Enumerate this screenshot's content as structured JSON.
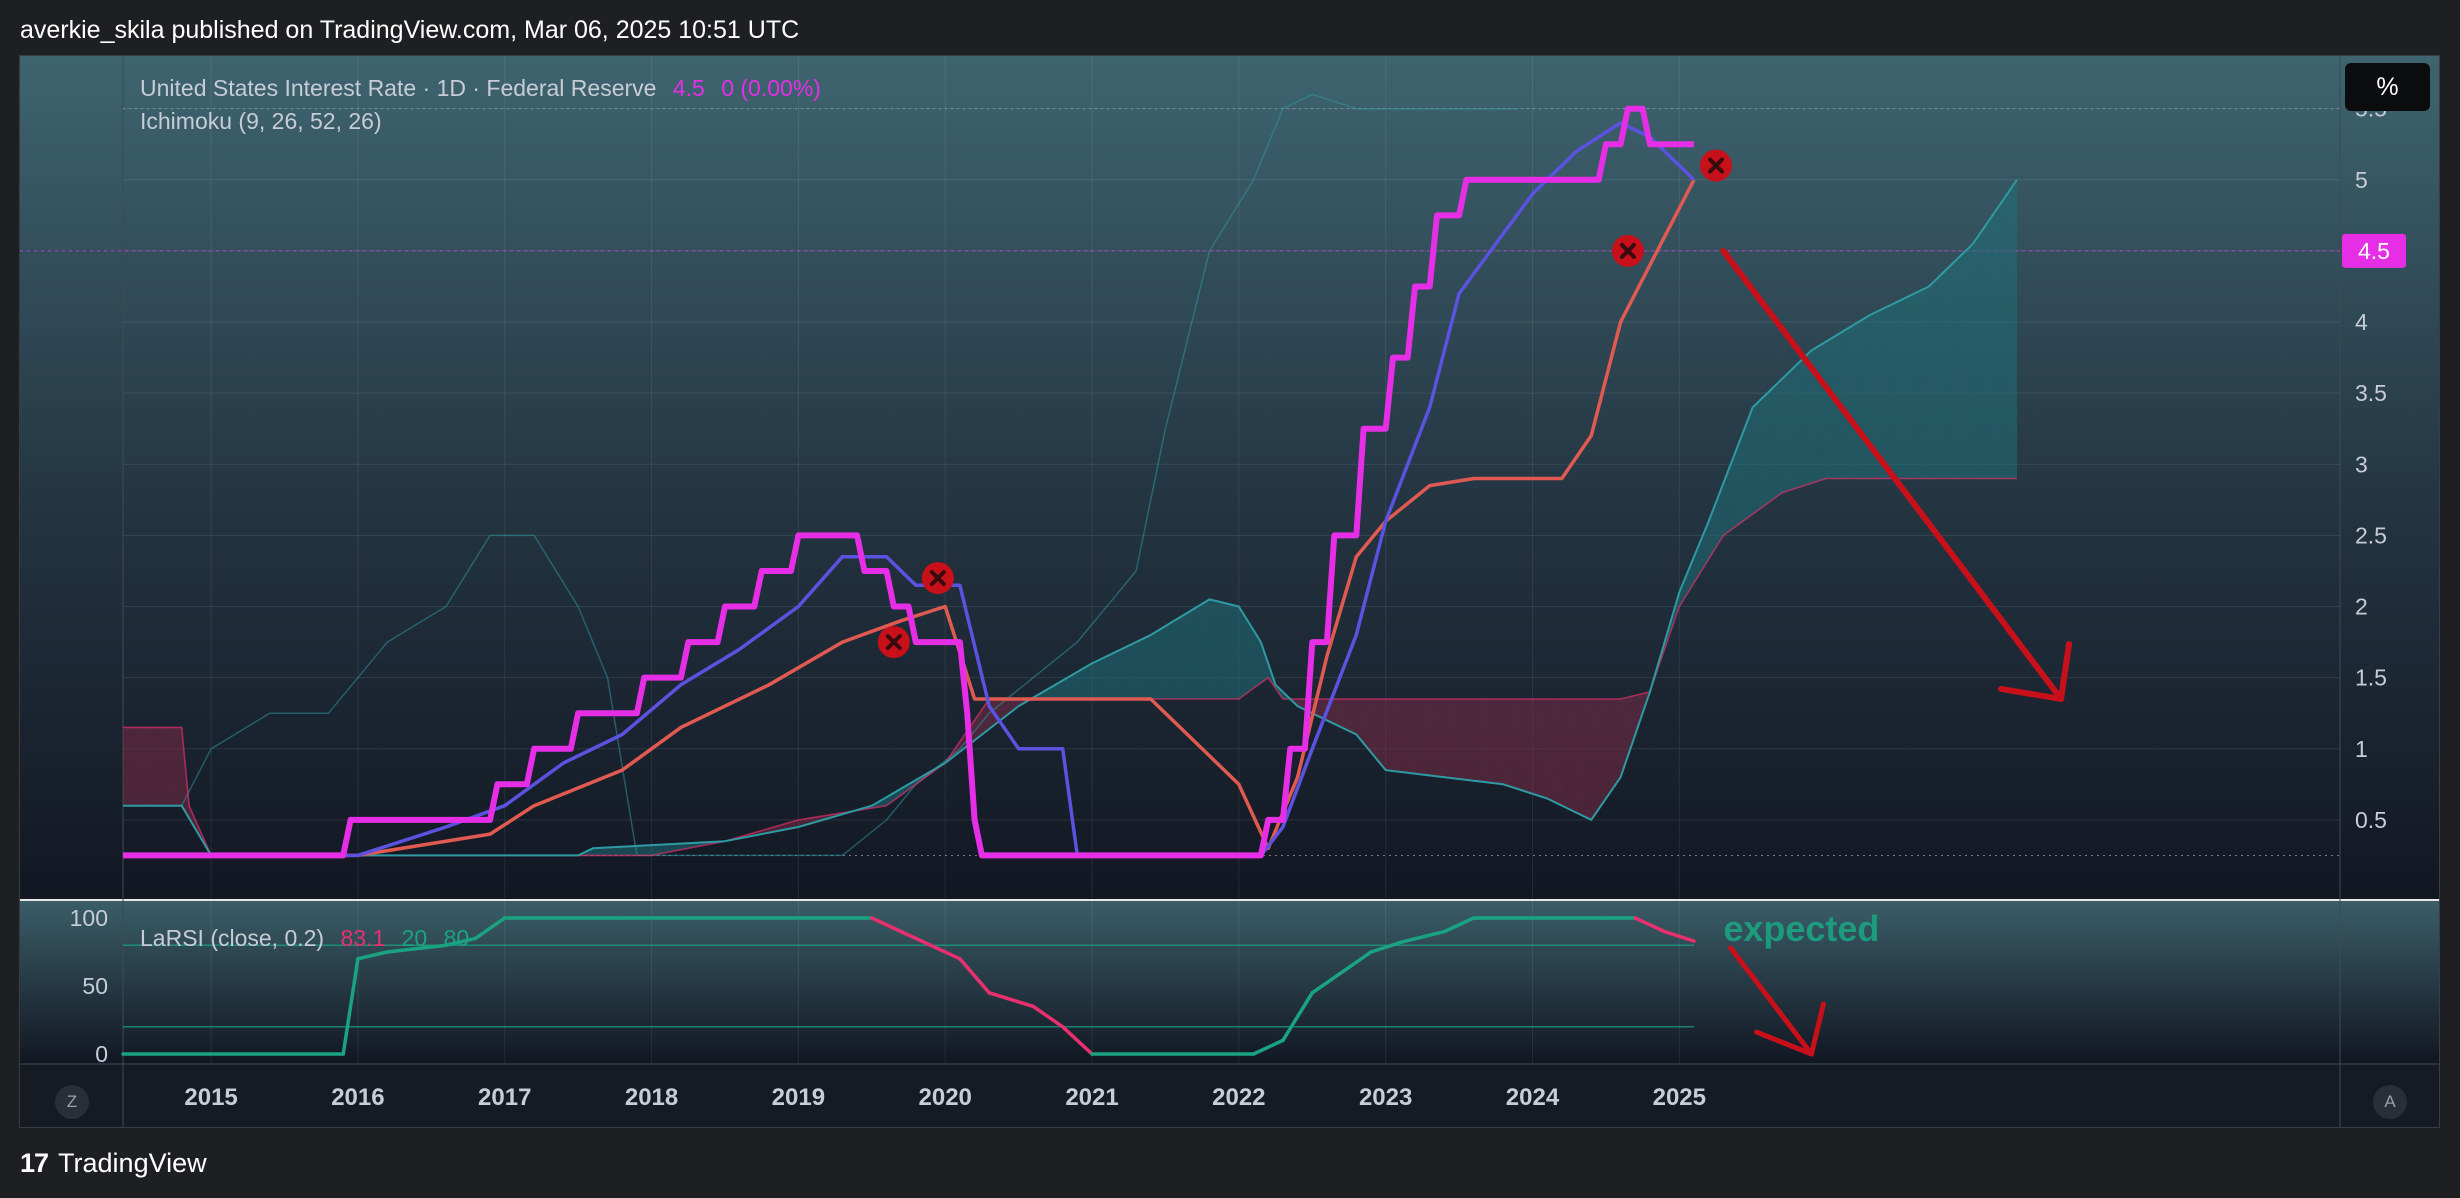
{
  "header": {
    "publisher": "averkie_skila published on TradingView.com, Mar 06, 2025 10:51 UTC"
  },
  "footer": {
    "brand": "TradingView",
    "logo_glyph": "17"
  },
  "legend": {
    "title": "United States Interest Rate · 1D · Federal Reserve",
    "last": "4.5",
    "change": "0 (0.00%)",
    "ichimoku": "Ichimoku (9, 26, 52, 26)",
    "larsi_label": "LaRSI (close, 0.2)",
    "larsi_value": "83.1",
    "larsi_low": "20",
    "larsi_high": "80"
  },
  "controls": {
    "percent_label": "%",
    "z_label": "Z",
    "a_label": "A"
  },
  "annotations": {
    "expected": "expected"
  },
  "price_badge": "4.5",
  "colors": {
    "price": "#e62ee6",
    "tenkan": "#5b52e0",
    "kijun": "#e05a52",
    "lagging": "#2e9aa3",
    "cloud_bull": "#1f6f78",
    "cloud_bear": "#7a2b47",
    "larsi_up": "#1aa381",
    "larsi_down": "#e8306f",
    "arrow": "#c8101a"
  },
  "chart_data": [
    {
      "type": "line",
      "title": "United States Interest Rate · 1D · Federal Reserve",
      "x_ticks": [
        "2015",
        "2016",
        "2017",
        "2018",
        "2019",
        "2020",
        "2021",
        "2022",
        "2023",
        "2024",
        "2025"
      ],
      "y_ticks": [
        "0.5",
        "1",
        "1.5",
        "2",
        "2.5",
        "3",
        "3.5",
        "4",
        "4.5",
        "5",
        "5.5"
      ],
      "ylim": [
        0,
        5.8
      ],
      "xlim": [
        2014.4,
        2029.5
      ],
      "grid": true,
      "series": [
        {
          "name": "United States Interest Rate",
          "x": [
            2014.4,
            2015.9,
            2015.95,
            2016.9,
            2016.95,
            2017.15,
            2017.2,
            2017.45,
            2017.5,
            2017.9,
            2017.95,
            2018.2,
            2018.25,
            2018.45,
            2018.5,
            2018.7,
            2018.75,
            2018.95,
            2019.0,
            2019.4,
            2019.45,
            2019.6,
            2019.65,
            2019.75,
            2019.8,
            2020.1,
            2020.15,
            2020.2,
            2020.25,
            2022.15,
            2022.2,
            2022.3,
            2022.35,
            2022.45,
            2022.5,
            2022.6,
            2022.65,
            2022.8,
            2022.85,
            2023.0,
            2023.05,
            2023.15,
            2023.2,
            2023.3,
            2023.35,
            2023.5,
            2023.55,
            2024.45,
            2024.5,
            2024.6,
            2024.65,
            2024.75,
            2024.8,
            2025.1
          ],
          "y": [
            0.25,
            0.25,
            0.5,
            0.5,
            0.75,
            0.75,
            1.0,
            1.0,
            1.25,
            1.25,
            1.5,
            1.5,
            1.75,
            1.75,
            2.0,
            2.0,
            2.25,
            2.25,
            2.5,
            2.5,
            2.25,
            2.25,
            2.0,
            2.0,
            1.75,
            1.75,
            1.25,
            0.5,
            0.25,
            0.25,
            0.5,
            0.5,
            1.0,
            1.0,
            1.75,
            1.75,
            2.5,
            2.5,
            3.25,
            3.25,
            3.75,
            3.75,
            4.25,
            4.25,
            4.75,
            4.75,
            5.0,
            5.0,
            5.25,
            5.25,
            5.5,
            5.5,
            5.25,
            5.25
          ]
        },
        {
          "name": "Tenkan",
          "x": [
            2014.4,
            2016.0,
            2016.6,
            2017.0,
            2017.4,
            2017.8,
            2018.2,
            2018.6,
            2019.0,
            2019.3,
            2019.6,
            2019.8,
            2020.1,
            2020.3,
            2020.5,
            2020.8,
            2020.9,
            2022.15,
            2022.3,
            2022.5,
            2022.8,
            2023.0,
            2023.3,
            2023.5,
            2024.0,
            2024.3,
            2024.6,
            2024.8,
            2025.1
          ],
          "y": [
            0.25,
            0.25,
            0.45,
            0.6,
            0.9,
            1.1,
            1.45,
            1.7,
            2.0,
            2.35,
            2.35,
            2.15,
            2.15,
            1.3,
            1.0,
            1.0,
            0.25,
            0.25,
            0.45,
            1.0,
            1.8,
            2.6,
            3.4,
            4.2,
            4.9,
            5.2,
            5.4,
            5.3,
            5.0
          ]
        },
        {
          "name": "Kijun",
          "x": [
            2014.4,
            2016.0,
            2016.9,
            2017.2,
            2017.8,
            2018.2,
            2018.8,
            2019.3,
            2019.7,
            2020.0,
            2020.2,
            2020.3,
            2021.4,
            2021.7,
            2022.0,
            2022.2,
            2022.4,
            2022.6,
            2022.8,
            2023.0,
            2023.3,
            2023.6,
            2024.2,
            2024.4,
            2024.6,
            2024.8,
            2025.1
          ],
          "y": [
            0.25,
            0.25,
            0.4,
            0.6,
            0.85,
            1.15,
            1.45,
            1.75,
            1.9,
            2.0,
            1.35,
            1.35,
            1.35,
            1.05,
            0.75,
            0.3,
            0.8,
            1.65,
            2.35,
            2.6,
            2.85,
            2.9,
            2.9,
            3.2,
            4.0,
            4.4,
            5.0
          ]
        },
        {
          "name": "Lagging Span",
          "x": [
            2014.4,
            2014.8,
            2015.0,
            2015.4,
            2015.8,
            2016.2,
            2016.6,
            2016.9,
            2017.2,
            2017.5,
            2017.7,
            2017.9,
            2019.3,
            2019.6,
            2019.8,
            2020.1,
            2020.3,
            2020.6,
            2020.9,
            2021.3,
            2021.5,
            2021.8,
            2022.1,
            2022.3,
            2022.5,
            2022.8,
            2023.3,
            2023.6,
            2023.9
          ],
          "y": [
            0.6,
            0.6,
            1.0,
            1.25,
            1.25,
            1.75,
            2.0,
            2.5,
            2.5,
            2.0,
            1.5,
            0.25,
            0.25,
            0.5,
            0.75,
            1.0,
            1.25,
            1.5,
            1.75,
            2.25,
            3.25,
            4.5,
            5.0,
            5.5,
            5.6,
            5.5,
            5.5,
            5.5,
            5.5
          ]
        },
        {
          "name": "Senkou A",
          "x": [
            2014.4,
            2014.8,
            2015.0,
            2015.8,
            2016.8,
            2017.5,
            2017.6,
            2018.5,
            2019.0,
            2019.5,
            2020.0,
            2020.5,
            2021.0,
            2021.4,
            2021.8,
            2022.0,
            2022.15,
            2022.25,
            2022.4,
            2022.6,
            2022.8,
            2023.0,
            2023.4,
            2023.8,
            2024.1,
            2024.4,
            2024.6,
            2024.8,
            2025.0,
            2025.2,
            2025.5,
            2025.9,
            2026.3,
            2026.7,
            2027.0,
            2027.3
          ],
          "y": [
            0.6,
            0.6,
            0.25,
            0.25,
            0.25,
            0.25,
            0.3,
            0.35,
            0.45,
            0.6,
            0.9,
            1.3,
            1.6,
            1.8,
            2.05,
            2.0,
            1.75,
            1.45,
            1.3,
            1.2,
            1.1,
            0.85,
            0.8,
            0.75,
            0.65,
            0.5,
            0.8,
            1.4,
            2.1,
            2.6,
            3.4,
            3.8,
            4.05,
            4.25,
            4.55,
            5.0
          ]
        },
        {
          "name": "Senkou B",
          "x": [
            2014.4,
            2014.8,
            2014.85,
            2015.0,
            2015.8,
            2016.8,
            2017.5,
            2018.0,
            2018.5,
            2019.0,
            2019.6,
            2020.0,
            2020.3,
            2021.0,
            2022.0,
            2022.2,
            2022.3,
            2023.0,
            2024.0,
            2024.6,
            2024.8,
            2025.0,
            2025.3,
            2025.7,
            2026.0,
            2027.3
          ],
          "y": [
            1.15,
            1.15,
            0.6,
            0.25,
            0.25,
            0.25,
            0.25,
            0.25,
            0.35,
            0.5,
            0.6,
            0.9,
            1.35,
            1.35,
            1.35,
            1.5,
            1.35,
            1.35,
            1.35,
            1.35,
            1.4,
            2.0,
            2.5,
            2.8,
            2.9,
            2.9
          ]
        }
      ]
    },
    {
      "type": "line",
      "title": "LaRSI (close, 0.2)",
      "y_ticks": [
        "100",
        "50",
        "0"
      ],
      "ylim": [
        0,
        100
      ],
      "levels": [
        20,
        80
      ],
      "series": [
        {
          "name": "LaRSI",
          "x": [
            2014.4,
            2015.9,
            2016.0,
            2016.2,
            2016.6,
            2016.8,
            2017.0,
            2017.6,
            2017.8,
            2019.5,
            2019.7,
            2019.9,
            2020.1,
            2020.3,
            2020.6,
            2020.8,
            2021.0,
            2022.1,
            2022.3,
            2022.5,
            2022.7,
            2022.9,
            2023.1,
            2023.4,
            2023.6,
            2024.5,
            2024.7,
            2024.9,
            2025.1
          ],
          "y": [
            0,
            0,
            70,
            75,
            80,
            85,
            100,
            100,
            100,
            100,
            90,
            80,
            70,
            45,
            35,
            20,
            0,
            0,
            10,
            45,
            60,
            75,
            82,
            90,
            100,
            100,
            100,
            90,
            83
          ]
        }
      ]
    }
  ]
}
